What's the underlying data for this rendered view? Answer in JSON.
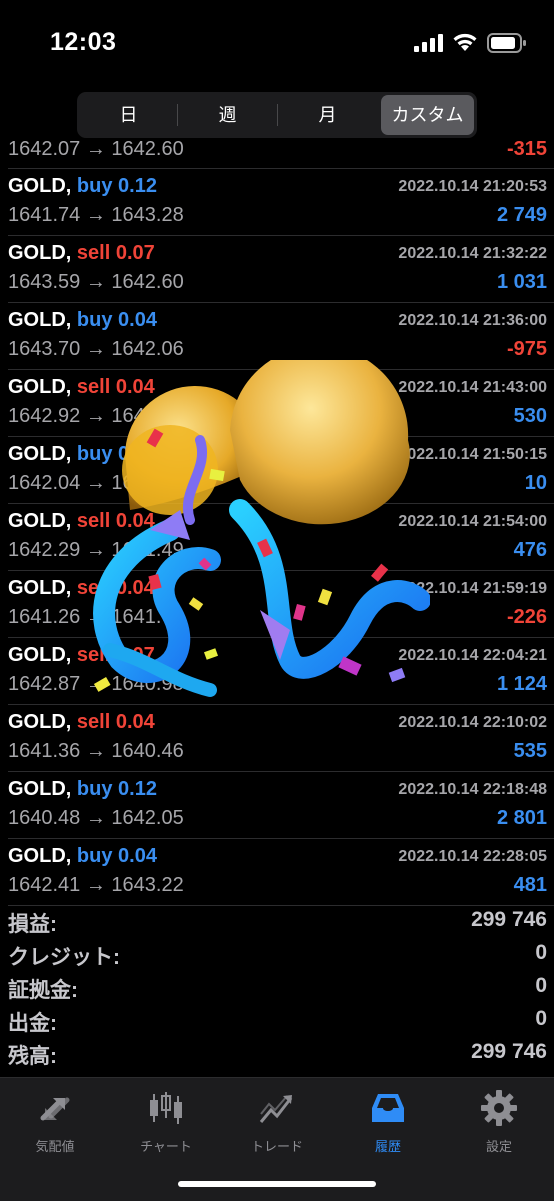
{
  "status": {
    "time": "12:03"
  },
  "segments": [
    {
      "label": "日",
      "active": false
    },
    {
      "label": "週",
      "active": false
    },
    {
      "label": "月",
      "active": false
    },
    {
      "label": "カスタム",
      "active": true
    }
  ],
  "first_row": {
    "prices": "1642.07 → 1642.60",
    "profit": "-315"
  },
  "trades": [
    {
      "symbol": "GOLD,",
      "side": "buy",
      "lots": "0.12",
      "datetime": "2022.10.14 21:20:53",
      "prices": "1641.74 → 1643.28",
      "profit": "2 749"
    },
    {
      "symbol": "GOLD,",
      "side": "sell",
      "lots": "0.07",
      "datetime": "2022.10.14 21:32:22",
      "prices": "1643.59 → 1642.60",
      "profit": "1 031"
    },
    {
      "symbol": "GOLD,",
      "side": "buy",
      "lots": "0.04",
      "datetime": "2022.10.14 21:36:00",
      "prices": "1643.70 → 1642.06",
      "profit": "-975"
    },
    {
      "symbol": "GOLD,",
      "side": "sell",
      "lots": "0.04",
      "datetime": "2022.10.14 21:43:00",
      "prices": "1642.92 → 1642.39",
      "profit": "530"
    },
    {
      "symbol": "GOLD,",
      "side": "buy",
      "lots": "0.04",
      "datetime": "2022.10.14 21:50:15",
      "prices": "1642.04 → 1642.09",
      "profit": "10"
    },
    {
      "symbol": "GOLD,",
      "side": "sell",
      "lots": "0.04",
      "datetime": "2022.10.14 21:54:00",
      "prices": "1642.29 → 1641.49",
      "profit": "476"
    },
    {
      "symbol": "GOLD,",
      "side": "sell",
      "lots": "0.04",
      "datetime": "2022.10.14 21:59:19",
      "prices": "1641.26 → 1641.64",
      "profit": "-226"
    },
    {
      "symbol": "GOLD,",
      "side": "sell",
      "lots": "0.07",
      "datetime": "2022.10.14 22:04:21",
      "prices": "1642.87 → 1640.98",
      "profit": "1 124"
    },
    {
      "symbol": "GOLD,",
      "side": "sell",
      "lots": "0.04",
      "datetime": "2022.10.14 22:10:02",
      "prices": "1641.36 → 1640.46",
      "profit": "535"
    },
    {
      "symbol": "GOLD,",
      "side": "buy",
      "lots": "0.12",
      "datetime": "2022.10.14 22:18:48",
      "prices": "1640.48 → 1642.05",
      "profit": "2 801"
    },
    {
      "symbol": "GOLD,",
      "side": "buy",
      "lots": "0.04",
      "datetime": "2022.10.14 22:28:05",
      "prices": "1642.41 → 1643.22",
      "profit": "481"
    }
  ],
  "summary": [
    {
      "label": "損益:",
      "value": "299 746"
    },
    {
      "label": "クレジット:",
      "value": "0"
    },
    {
      "label": "証拠金:",
      "value": "0"
    },
    {
      "label": "出金:",
      "value": "0"
    },
    {
      "label": "残高:",
      "value": "299 746"
    }
  ],
  "tabs": [
    {
      "label": "気配値",
      "icon": "quotes-arrows-icon",
      "active": false
    },
    {
      "label": "チャート",
      "icon": "candlestick-icon",
      "active": false
    },
    {
      "label": "トレード",
      "icon": "trade-chart-icon",
      "active": false
    },
    {
      "label": "履歴",
      "icon": "inbox-tray-icon",
      "active": true
    },
    {
      "label": "設定",
      "icon": "gear-icon",
      "active": false
    }
  ],
  "colors": {
    "buy": "#3a8ef0",
    "sell": "#f04438",
    "active_tab": "#2f8cf6"
  }
}
